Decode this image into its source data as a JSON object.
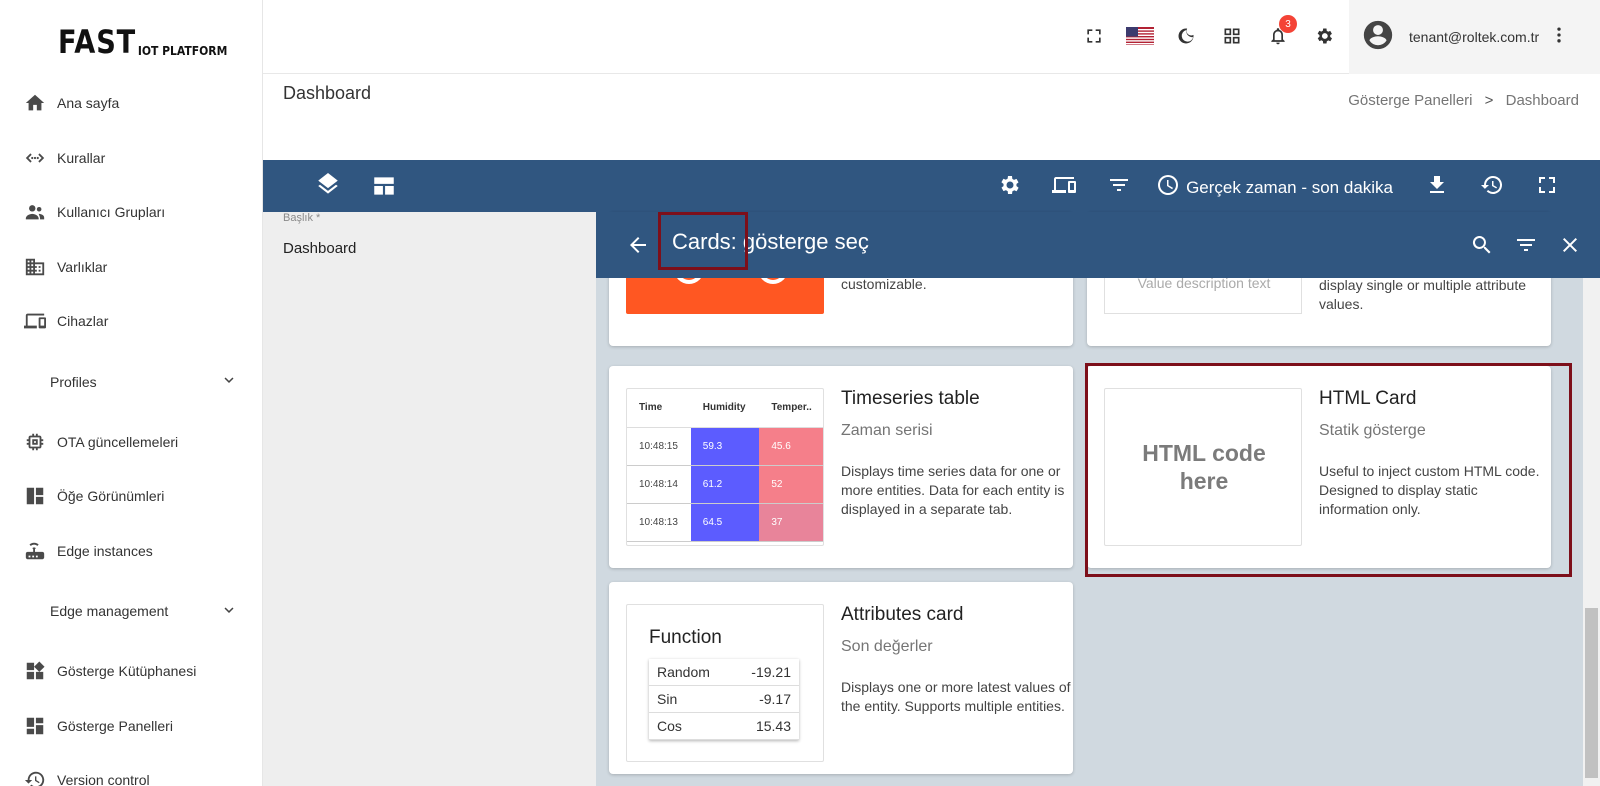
{
  "logo": {
    "main": "FAST",
    "sub": "IOT PLATFORM"
  },
  "sidebar": {
    "items": [
      {
        "label": "Ana sayfa",
        "icon": "home-icon"
      },
      {
        "label": "Kurallar",
        "icon": "rule-chain-icon"
      },
      {
        "label": "Kullanıcı Grupları",
        "icon": "user-groups-icon"
      },
      {
        "label": "Varlıklar",
        "icon": "assets-icon"
      },
      {
        "label": "Cihazlar",
        "icon": "devices-icon"
      },
      {
        "label": "Profiles",
        "group": true
      },
      {
        "label": "OTA güncellemeleri",
        "icon": "ota-chip-icon"
      },
      {
        "label": "Öğe Görünümleri",
        "icon": "entity-views-icon"
      },
      {
        "label": "Edge instances",
        "icon": "router-icon"
      },
      {
        "label": "Edge management",
        "group": true
      },
      {
        "label": "Gösterge Kütüphanesi",
        "icon": "widgets-library-icon"
      },
      {
        "label": "Gösterge Panelleri",
        "icon": "dashboards-icon"
      },
      {
        "label": "Version control",
        "icon": "history-icon"
      }
    ]
  },
  "topbar": {
    "notification_count": "3",
    "user_email": "tenant@roltek.com.tr"
  },
  "page": {
    "title": "Dashboard",
    "breadcrumb": [
      "Gösterge Panelleri",
      "Dashboard"
    ],
    "breadcrumb_sep": ">"
  },
  "toolbar": {
    "timewindow": "Gerçek zaman - son dakika"
  },
  "editor": {
    "field_label": "Başlık *",
    "field_value": "Dashboard"
  },
  "panel": {
    "title": "Cards: gösterge seç",
    "top_partial": {
      "left_desc": "customizable.",
      "right_thumb_text": "Value description text",
      "right_desc": "display single or multiple attribute values."
    },
    "cards": [
      {
        "title": "Timeseries table",
        "subtitle": "Zaman serisi",
        "desc": "Displays time series data for one or more entities. Data for each entity is displayed in a separate tab.",
        "table": {
          "headers": [
            "Time",
            "Humidity",
            "Temper.."
          ],
          "rows": [
            [
              "10:48:15",
              "59.3",
              "45.6"
            ],
            [
              "10:48:14",
              "61.2",
              "52"
            ],
            [
              "10:48:13",
              "64.5",
              "37"
            ]
          ]
        }
      },
      {
        "title": "HTML Card",
        "subtitle": "Statik gösterge",
        "desc": "Useful to inject custom HTML code. Designed to display static information only.",
        "thumb_text_1": "HTML code",
        "thumb_text_2": "here"
      },
      {
        "title": "Attributes card",
        "subtitle": "Son değerler",
        "desc": "Displays one or more latest values of the entity. Supports multiple entities.",
        "thumb_title": "Function",
        "rows": [
          [
            "Random",
            "-19.21"
          ],
          [
            "Sin",
            "-9.17"
          ],
          [
            "Cos",
            "15.43"
          ]
        ]
      }
    ]
  },
  "colors": {
    "primary": "#305680",
    "highlight": "#7d0f1a",
    "orange": "#ff5722",
    "badge": "#f44336"
  }
}
